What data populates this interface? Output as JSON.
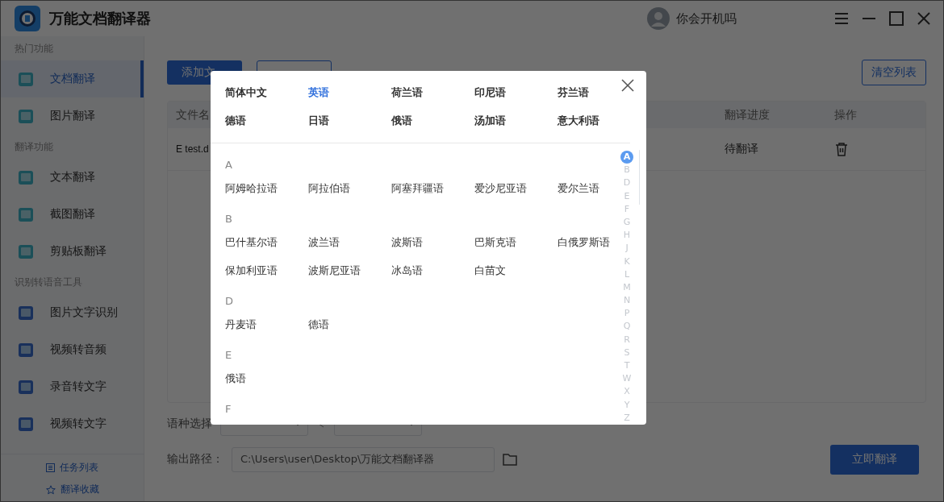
{
  "window": {
    "title": "万能文档翻译器",
    "user": "你会开机吗"
  },
  "sidebar": {
    "sections": [
      {
        "title": "热门功能",
        "items": [
          {
            "label": "文档翻译",
            "selected": true
          },
          {
            "label": "图片翻译",
            "selected": false
          }
        ]
      },
      {
        "title": "翻译功能",
        "items": [
          {
            "label": "文本翻译",
            "selected": false
          },
          {
            "label": "截图翻译",
            "selected": false
          },
          {
            "label": "剪贴板翻译",
            "selected": false
          }
        ]
      },
      {
        "title": "识别转语音工具",
        "items": [
          {
            "label": "图片文字识别",
            "selected": false
          },
          {
            "label": "视频转音频",
            "selected": false
          },
          {
            "label": "录音转文字",
            "selected": false
          },
          {
            "label": "视频转文字",
            "selected": false
          }
        ]
      }
    ],
    "footer_links": [
      {
        "kind": "list",
        "label": "任务列表"
      },
      {
        "kind": "star",
        "label": "翻译收藏"
      }
    ]
  },
  "toolbar": {
    "add_file": "添加文",
    "clear": "清空列表"
  },
  "table": {
    "columns": [
      "文件名",
      "翻译进度",
      "操作"
    ],
    "rows": [
      {
        "file": "E test.d",
        "progress": "待翻译"
      }
    ]
  },
  "language_label": "语种选择",
  "output": {
    "label": "输出路径：",
    "value": "C:\\Users\\user\\Desktop\\万能文档翻译器"
  },
  "translate_button": "立即翻译",
  "language_picker": {
    "popular": [
      {
        "label": "简体中文",
        "selected": false
      },
      {
        "label": "英语",
        "selected": true
      },
      {
        "label": "荷兰语",
        "selected": false
      },
      {
        "label": "印尼语",
        "selected": false
      },
      {
        "label": "芬兰语",
        "selected": false
      },
      {
        "label": "德语",
        "selected": false
      },
      {
        "label": "日语",
        "selected": false
      },
      {
        "label": "俄语",
        "selected": false
      },
      {
        "label": "汤加语",
        "selected": false
      },
      {
        "label": "意大利语",
        "selected": false
      }
    ],
    "groups": [
      {
        "letter": "A",
        "languages": [
          "阿姆哈拉语",
          "阿拉伯语",
          "阿塞拜疆语",
          "爱沙尼亚语",
          "爱尔兰语"
        ]
      },
      {
        "letter": "B",
        "languages": [
          "巴什基尔语",
          "波兰语",
          "波斯语",
          "巴斯克语",
          "白俄罗斯语",
          "保加利亚语",
          "波斯尼亚语",
          "冰岛语",
          "白苗文"
        ]
      },
      {
        "letter": "D",
        "languages": [
          "丹麦语",
          "德语"
        ]
      },
      {
        "letter": "E",
        "languages": [
          "俄语"
        ]
      },
      {
        "letter": "F"
      }
    ],
    "index": [
      {
        "letter": "A",
        "selected": true
      },
      {
        "letter": "B",
        "selected": false
      },
      {
        "letter": "D",
        "selected": false
      },
      {
        "letter": "E",
        "selected": false
      },
      {
        "letter": "F",
        "selected": false
      },
      {
        "letter": "G",
        "selected": false
      },
      {
        "letter": "H",
        "selected": false
      },
      {
        "letter": "J",
        "selected": false
      },
      {
        "letter": "K",
        "selected": false
      },
      {
        "letter": "L",
        "selected": false
      },
      {
        "letter": "M",
        "selected": false
      },
      {
        "letter": "N",
        "selected": false
      },
      {
        "letter": "P",
        "selected": false
      },
      {
        "letter": "Q",
        "selected": false
      },
      {
        "letter": "R",
        "selected": false
      },
      {
        "letter": "S",
        "selected": false
      },
      {
        "letter": "T",
        "selected": false
      },
      {
        "letter": "W",
        "selected": false
      },
      {
        "letter": "X",
        "selected": false
      },
      {
        "letter": "Y",
        "selected": false
      },
      {
        "letter": "Z",
        "selected": false
      }
    ]
  }
}
